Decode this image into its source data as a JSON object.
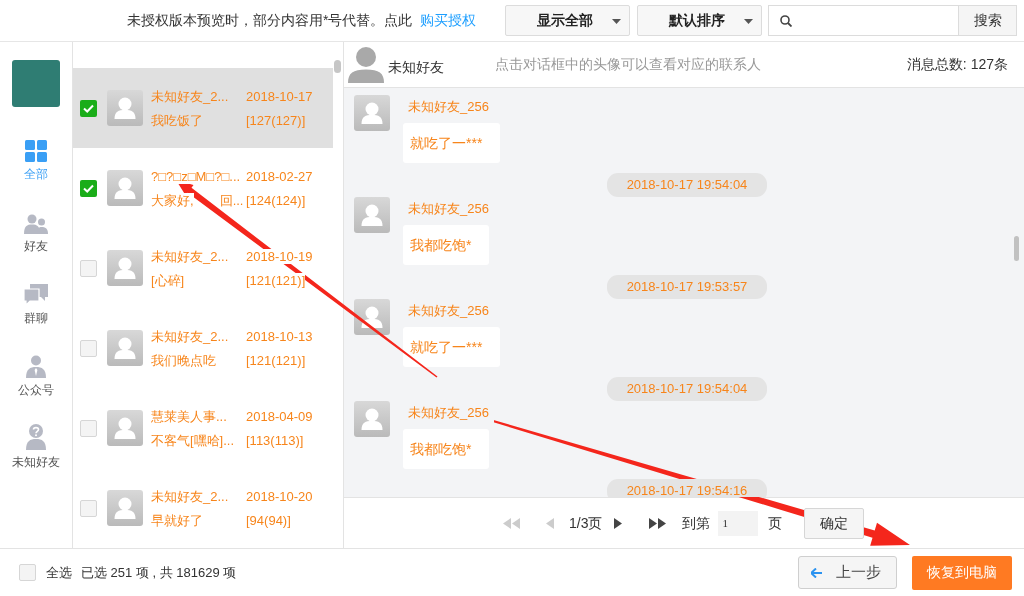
{
  "top_bar": {
    "notice": "未授权版本预览时，部分内容用*号代替。点此",
    "link": "购买授权",
    "filters": [
      {
        "label": "显示全部"
      },
      {
        "label": "默认排序"
      }
    ],
    "search": {
      "button": "搜索"
    }
  },
  "sidebar": {
    "items": [
      {
        "label": "全部",
        "kind": "all",
        "selected": true
      },
      {
        "label": "好友",
        "kind": "friends",
        "selected": false
      },
      {
        "label": "群聊",
        "kind": "groups",
        "selected": false
      },
      {
        "label": "公众号",
        "kind": "official",
        "selected": false
      },
      {
        "label": "未知好友",
        "kind": "unknown",
        "selected": false
      }
    ]
  },
  "contacts": [
    {
      "name": "未知好友_2...",
      "date": "2018-10-17",
      "preview": [
        "我吃饭了"
      ],
      "count": "[127(127)]",
      "checked": true,
      "selected": true
    },
    {
      "name": "?□?□z□M□?□...",
      "date": "2018-02-27",
      "preview": [
        "大家好,",
        "回..."
      ],
      "count": "[124(124)]",
      "checked": true,
      "selected": false
    },
    {
      "name": "未知好友_2...",
      "date": "2018-10-19",
      "preview": [
        "[心碎]"
      ],
      "count": "[121(121)]",
      "checked": false,
      "selected": false
    },
    {
      "name": "未知好友_2...",
      "date": "2018-10-13",
      "preview": [
        "我们晚点吃"
      ],
      "count": "[121(121)]",
      "checked": false,
      "selected": false
    },
    {
      "name": "慧莱美人事...",
      "date": "2018-04-09",
      "preview": [
        "不客气[嘿哈]..."
      ],
      "count": "[113(113)]",
      "checked": false,
      "selected": false
    },
    {
      "name": "未知好友_2...",
      "date": "2018-10-20",
      "preview": [
        "早就好了"
      ],
      "count": "[94(94)]",
      "checked": false,
      "selected": false
    }
  ],
  "chat": {
    "contact": "未知好友",
    "hint": "点击对话框中的头像可以查看对应的联系人",
    "total": "消息总数: 127条",
    "items": [
      {
        "kind": "message",
        "sender": "未知好友_256",
        "text": "就吃了一***"
      },
      {
        "kind": "time",
        "text": "2018-10-17 19:54:04"
      },
      {
        "kind": "message",
        "sender": "未知好友_256",
        "text": "我都吃饱*"
      },
      {
        "kind": "time",
        "text": "2018-10-17 19:53:57"
      },
      {
        "kind": "message",
        "sender": "未知好友_256",
        "text": "就吃了一***"
      },
      {
        "kind": "time",
        "text": "2018-10-17 19:54:04"
      },
      {
        "kind": "message",
        "sender": "未知好友_256",
        "text": "我都吃饱*"
      },
      {
        "kind": "time",
        "text": "2018-10-17 19:54:16"
      }
    ]
  },
  "pagination": {
    "controls": [
      {
        "kind": "first",
        "disabled": true
      },
      {
        "kind": "prev",
        "disabled": true
      },
      {
        "kind": "page",
        "text": "1/3页"
      },
      {
        "kind": "next",
        "disabled": false
      },
      {
        "kind": "last",
        "disabled": false
      }
    ],
    "goto_label": "到第",
    "goto_value": "1",
    "goto_unit": "页",
    "confirm": "确定"
  },
  "bottom_bar": {
    "select_all": {
      "label": "全选",
      "checked": false
    },
    "summary": "已选 251 项 , 共 181629 项",
    "back": "上一步",
    "restore": "恢复到电脑"
  }
}
